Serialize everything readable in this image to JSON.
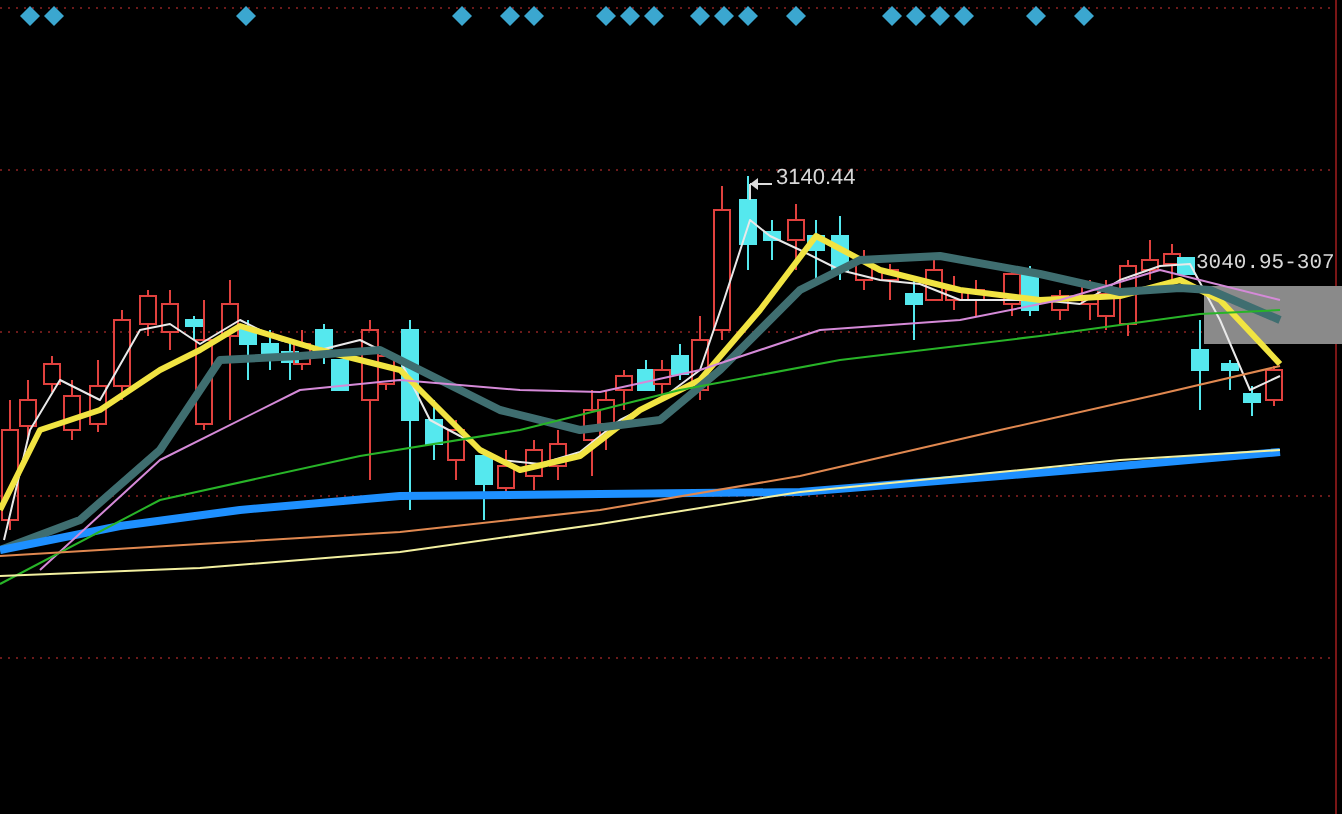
{
  "high_marker": {
    "label": "3140.44"
  },
  "price_readout": {
    "label": "3040.95-307"
  }
}
